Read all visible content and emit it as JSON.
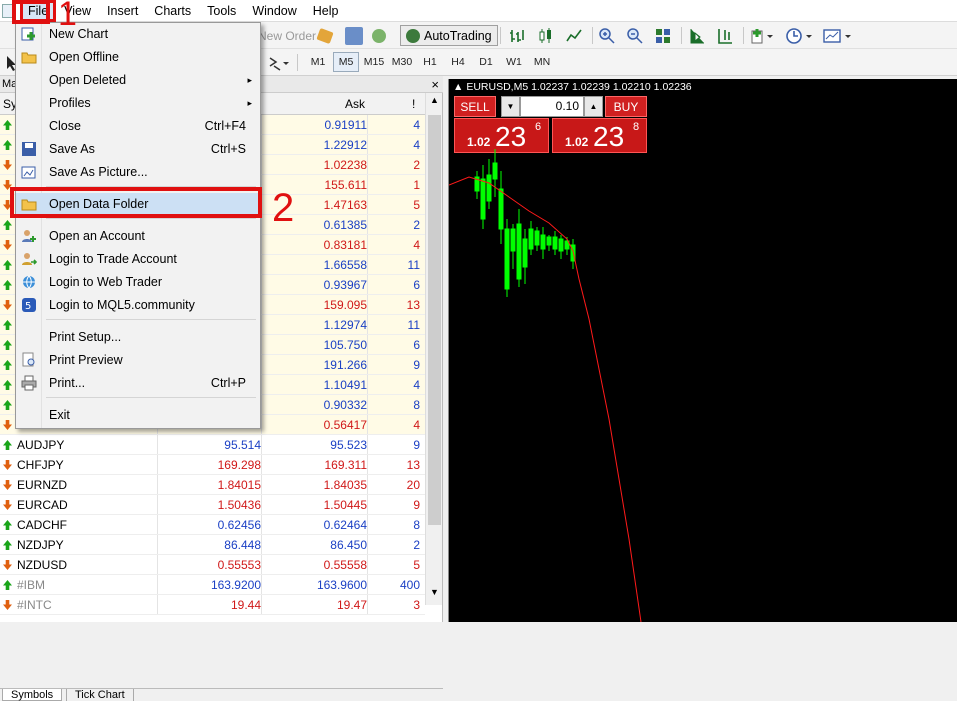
{
  "menubar": {
    "items": [
      "File",
      "View",
      "Insert",
      "Charts",
      "Tools",
      "Window",
      "Help"
    ]
  },
  "toolbar": {
    "new_order": "New Order",
    "autotrading": "AutoTrading",
    "timeframes": [
      "M1",
      "M5",
      "M15",
      "M30",
      "H1",
      "H4",
      "D1",
      "W1",
      "MN"
    ],
    "active_timeframe": "M5"
  },
  "file_menu": {
    "items": [
      {
        "label": "New Chart",
        "icon": "new-chart-icon"
      },
      {
        "label": "Open Offline",
        "icon": "folder-open-icon"
      },
      {
        "label": "Open Deleted",
        "submenu": "▸"
      },
      {
        "label": "Profiles",
        "submenu": "▸"
      },
      {
        "label": "Close",
        "shortcut": "Ctrl+F4"
      },
      {
        "label": "Save As",
        "shortcut": "Ctrl+S",
        "icon": "save-icon"
      },
      {
        "label": "Save As Picture...",
        "icon": "save-picture-icon"
      },
      {
        "label": "Open Data Folder",
        "icon": "folder-icon"
      },
      {
        "label": "Open an Account",
        "icon": "add-account-icon"
      },
      {
        "label": "Login to Trade Account",
        "icon": "login-icon"
      },
      {
        "label": "Login to Web Trader",
        "icon": "web-icon"
      },
      {
        "label": "Login to MQL5.community",
        "icon": "mql5-icon"
      },
      {
        "label": "Print Setup..."
      },
      {
        "label": "Print Preview",
        "icon": "print-preview-icon"
      },
      {
        "label": "Print...",
        "shortcut": "Ctrl+P",
        "icon": "printer-icon"
      },
      {
        "label": "Exit"
      }
    ]
  },
  "annotations": {
    "one": "1",
    "two": "2"
  },
  "market_watch": {
    "title": "Mar",
    "col_symbol": "Sy",
    "col_ask": "Ask",
    "col_spread": "!",
    "rows": [
      {
        "dir": "up",
        "symbol": "",
        "bid": "",
        "ask": "0.91911",
        "spread": "4",
        "color": "blue"
      },
      {
        "dir": "up",
        "symbol": "",
        "bid": "",
        "ask": "1.22912",
        "spread": "4",
        "color": "blue"
      },
      {
        "dir": "down",
        "symbol": "",
        "bid": "",
        "ask": "1.02238",
        "spread": "2",
        "color": "red"
      },
      {
        "dir": "down",
        "symbol": "",
        "bid": "",
        "ask": "155.611",
        "spread": "1",
        "color": "red"
      },
      {
        "dir": "down",
        "symbol": "",
        "bid": "",
        "ask": "1.47163",
        "spread": "5",
        "color": "red"
      },
      {
        "dir": "up",
        "symbol": "",
        "bid": "",
        "ask": "0.61385",
        "spread": "2",
        "color": "blue"
      },
      {
        "dir": "down",
        "symbol": "",
        "bid": "",
        "ask": "0.83181",
        "spread": "4",
        "color": "red"
      },
      {
        "dir": "up",
        "symbol": "",
        "bid": "",
        "ask": "1.66558",
        "spread": "11",
        "color": "blue"
      },
      {
        "dir": "up",
        "symbol": "",
        "bid": "",
        "ask": "0.93967",
        "spread": "6",
        "color": "blue"
      },
      {
        "dir": "down",
        "symbol": "",
        "bid": "",
        "ask": "159.095",
        "spread": "13",
        "color": "red"
      },
      {
        "dir": "up",
        "symbol": "",
        "bid": "",
        "ask": "1.12974",
        "spread": "11",
        "color": "blue"
      },
      {
        "dir": "up",
        "symbol": "",
        "bid": "",
        "ask": "105.750",
        "spread": "6",
        "color": "blue"
      },
      {
        "dir": "up",
        "symbol": "",
        "bid": "",
        "ask": "191.266",
        "spread": "9",
        "color": "blue"
      },
      {
        "dir": "up",
        "symbol": "",
        "bid": "",
        "ask": "1.10491",
        "spread": "4",
        "color": "blue"
      },
      {
        "dir": "up",
        "symbol": "",
        "bid": "",
        "ask": "0.90332",
        "spread": "8",
        "color": "blue"
      },
      {
        "dir": "down",
        "symbol": "",
        "bid": "",
        "ask": "0.56417",
        "spread": "4",
        "color": "red"
      },
      {
        "dir": "up",
        "symbol": "AUDJPY",
        "bid": "95.514",
        "ask": "95.523",
        "spread": "9",
        "color": "blue"
      },
      {
        "dir": "down",
        "symbol": "CHFJPY",
        "bid": "169.298",
        "ask": "169.311",
        "spread": "13",
        "color": "red"
      },
      {
        "dir": "down",
        "symbol": "EURNZD",
        "bid": "1.84015",
        "ask": "1.84035",
        "spread": "20",
        "color": "red"
      },
      {
        "dir": "down",
        "symbol": "EURCAD",
        "bid": "1.50436",
        "ask": "1.50445",
        "spread": "9",
        "color": "red"
      },
      {
        "dir": "up",
        "symbol": "CADCHF",
        "bid": "0.62456",
        "ask": "0.62464",
        "spread": "8",
        "color": "blue"
      },
      {
        "dir": "up",
        "symbol": "NZDJPY",
        "bid": "86.448",
        "ask": "86.450",
        "spread": "2",
        "color": "blue"
      },
      {
        "dir": "down",
        "symbol": "NZDUSD",
        "bid": "0.55553",
        "ask": "0.55558",
        "spread": "5",
        "color": "red"
      },
      {
        "dir": "up",
        "symbol": "#IBM",
        "bid": "163.9200",
        "ask": "163.9600",
        "spread": "400",
        "color": "blue",
        "gray": true
      },
      {
        "dir": "down",
        "symbol": "#INTC",
        "bid": "19.44",
        "ask": "19.47",
        "spread": "3",
        "color": "red",
        "gray": true
      }
    ],
    "tabs": [
      "Symbols",
      "Tick Chart"
    ]
  },
  "chart": {
    "header": "EURUSD,M5  1.02237 1.02239 1.02210 1.02236",
    "sell_label": "SELL",
    "buy_label": "BUY",
    "lot": "0.10",
    "sell_price": {
      "prefix": "1.02",
      "big": "23",
      "sup": "6"
    },
    "buy_price": {
      "prefix": "1.02",
      "big": "23",
      "sup": "8"
    },
    "colors": {
      "background": "#000000",
      "candle": "#00ff00",
      "ma_line": "#ff0000"
    }
  }
}
